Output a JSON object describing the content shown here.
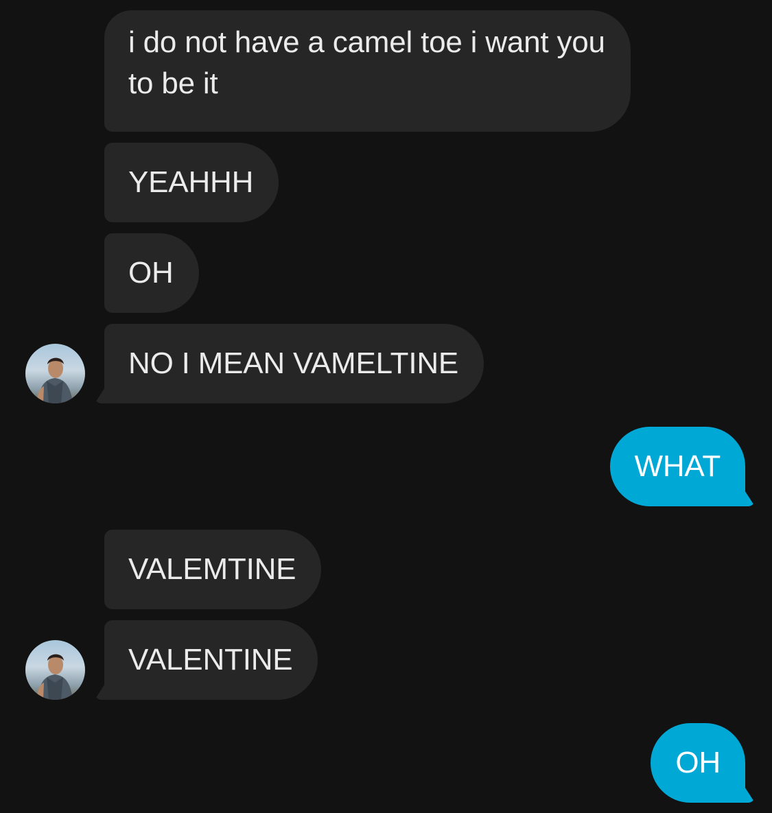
{
  "conversation": {
    "messages": [
      {
        "side": "incoming",
        "text": "i do not have a camel toe i want you to be it"
      },
      {
        "side": "incoming",
        "text": "YEAHHH"
      },
      {
        "side": "incoming",
        "text": "OH"
      },
      {
        "side": "incoming",
        "text": "NO I MEAN VAMELTINE"
      },
      {
        "side": "outgoing",
        "text": "WHAT"
      },
      {
        "side": "incoming",
        "text": "VALEMTINE"
      },
      {
        "side": "incoming",
        "text": "VALENTINE"
      },
      {
        "side": "outgoing",
        "text": "OH"
      }
    ]
  },
  "colors": {
    "background": "#121213",
    "incoming_bubble": "#262627",
    "outgoing_bubble": "#00a8d6"
  },
  "icons": {
    "avatar": "contact-avatar-photo"
  }
}
